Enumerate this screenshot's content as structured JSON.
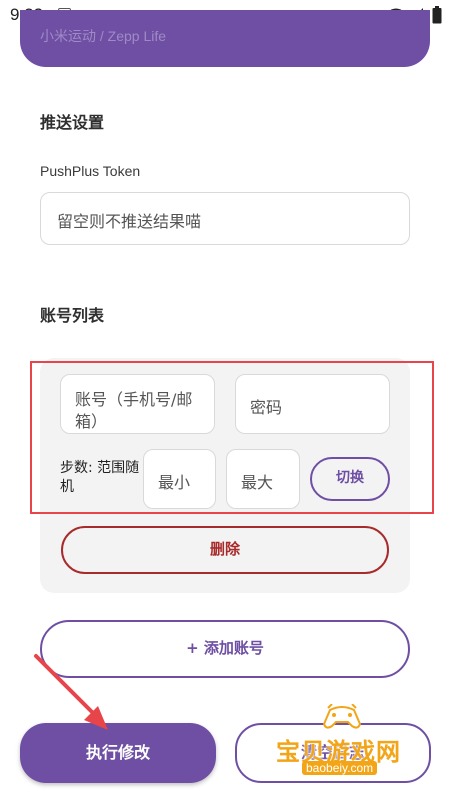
{
  "status_bar": {
    "time": "9:23",
    "a_icon": "A",
    "icons": [
      "a-icon",
      "keyboard-icon",
      "wifi-icon",
      "signal-icon",
      "battery-icon"
    ]
  },
  "banner": {
    "partial_text": "小米运动 / Zepp Life"
  },
  "push": {
    "section_title": "推送设置",
    "token_label": "PushPlus Token",
    "token_placeholder": "留空则不推送结果喵"
  },
  "accounts": {
    "section_title": "账号列表",
    "account_placeholder": "账号（手机号/邮箱）",
    "password_placeholder": "密码",
    "steps_label": "步数: 范围随机",
    "min_placeholder": "最小",
    "max_placeholder": "最大",
    "toggle_label": "切换",
    "delete_label": "删除"
  },
  "actions": {
    "add_account_label": "+ 添加账号",
    "execute_label": "执行修改",
    "secondary_label": "清空日志"
  },
  "watermark": {
    "text": "宝贝游戏网",
    "url": "baobeiy.com"
  },
  "colors": {
    "primary": "#6e4fa3",
    "danger": "#a72b2b",
    "highlight": "#e8454a",
    "card_bg": "#f4f3f4"
  }
}
